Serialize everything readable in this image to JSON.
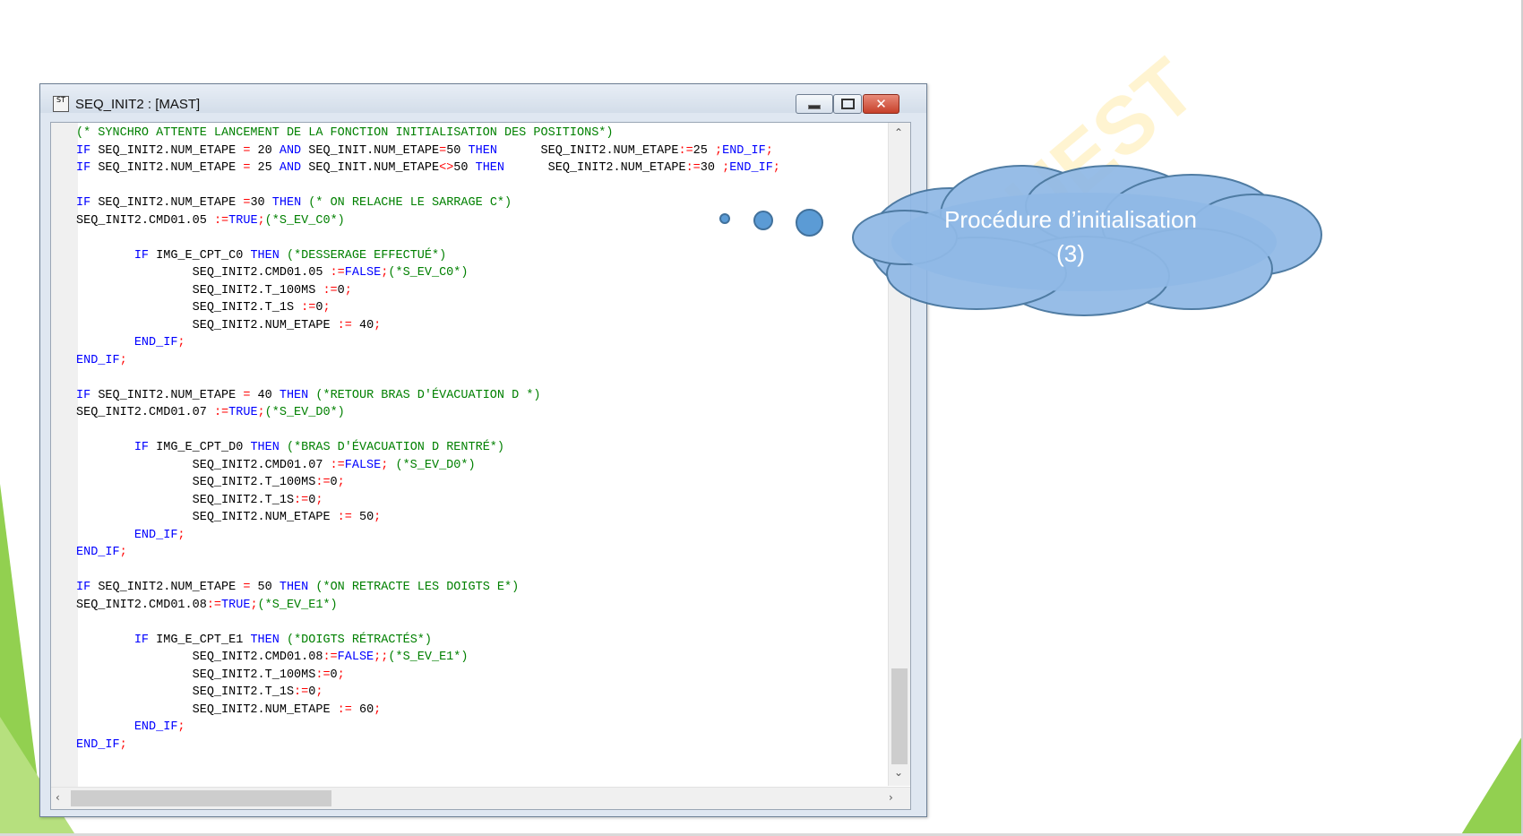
{
  "window": {
    "title": "SEQ_INIT2 : [MAST]",
    "icon_label": "ST"
  },
  "code_lines": [
    [
      [
        "cm",
        "(* SYNCHRO ATTENTE LANCEMENT DE LA FONCTION INITIALISATION DES POSITIONS*)"
      ]
    ],
    [
      [
        "kw",
        "IF "
      ],
      [
        "num",
        "SEQ_INIT2.NUM_ETAPE "
      ],
      [
        "op",
        "= "
      ],
      [
        "num",
        "20 "
      ],
      [
        "kw",
        "AND "
      ],
      [
        "num",
        "SEQ_INIT.NUM_ETAPE"
      ],
      [
        "op",
        "="
      ],
      [
        "num",
        "50 "
      ],
      [
        "kw",
        "THEN"
      ],
      [
        "num",
        "      SEQ_INIT2.NUM_ETAPE"
      ],
      [
        "op",
        ":="
      ],
      [
        "num",
        "25 "
      ],
      [
        "op",
        ";"
      ],
      [
        "kw",
        "END_IF"
      ],
      [
        "op",
        ";"
      ]
    ],
    [
      [
        "kw",
        "IF "
      ],
      [
        "num",
        "SEQ_INIT2.NUM_ETAPE "
      ],
      [
        "op",
        "= "
      ],
      [
        "num",
        "25 "
      ],
      [
        "kw",
        "AND "
      ],
      [
        "num",
        "SEQ_INIT.NUM_ETAPE"
      ],
      [
        "op",
        "<>"
      ],
      [
        "num",
        "50 "
      ],
      [
        "kw",
        "THEN"
      ],
      [
        "num",
        "      SEQ_INIT2.NUM_ETAPE"
      ],
      [
        "op",
        ":="
      ],
      [
        "num",
        "30 "
      ],
      [
        "op",
        ";"
      ],
      [
        "kw",
        "END_IF"
      ],
      [
        "op",
        ";"
      ]
    ],
    [],
    [
      [
        "kw",
        "IF "
      ],
      [
        "num",
        "SEQ_INIT2.NUM_ETAPE "
      ],
      [
        "op",
        "="
      ],
      [
        "num",
        "30 "
      ],
      [
        "kw",
        "THEN "
      ],
      [
        "cm",
        "(* ON RELACHE LE SARRAGE C*)"
      ]
    ],
    [
      [
        "num",
        "SEQ_INIT2.CMD01.05 "
      ],
      [
        "op",
        ":="
      ],
      [
        "kw",
        "TRUE"
      ],
      [
        "op",
        ";"
      ],
      [
        "cm",
        "(*S_EV_C0*)"
      ]
    ],
    [],
    [
      [
        "num",
        "        "
      ],
      [
        "kw",
        "IF "
      ],
      [
        "num",
        "IMG_E_CPT_C0 "
      ],
      [
        "kw",
        "THEN "
      ],
      [
        "cm",
        "(*DESSERAGE EFFECTUÉ*)"
      ]
    ],
    [
      [
        "num",
        "                SEQ_INIT2.CMD01.05 "
      ],
      [
        "op",
        ":="
      ],
      [
        "kw",
        "FALSE"
      ],
      [
        "op",
        ";"
      ],
      [
        "cm",
        "(*S_EV_C0*)"
      ]
    ],
    [
      [
        "num",
        "                SEQ_INIT2.T_100MS "
      ],
      [
        "op",
        ":="
      ],
      [
        "num",
        "0"
      ],
      [
        "op",
        ";"
      ]
    ],
    [
      [
        "num",
        "                SEQ_INIT2.T_1S "
      ],
      [
        "op",
        ":="
      ],
      [
        "num",
        "0"
      ],
      [
        "op",
        ";"
      ]
    ],
    [
      [
        "num",
        "                SEQ_INIT2.NUM_ETAPE "
      ],
      [
        "op",
        ":= "
      ],
      [
        "num",
        "40"
      ],
      [
        "op",
        ";"
      ]
    ],
    [
      [
        "num",
        "        "
      ],
      [
        "kw",
        "END_IF"
      ],
      [
        "op",
        ";"
      ]
    ],
    [
      [
        "kw",
        "END_IF"
      ],
      [
        "op",
        ";"
      ]
    ],
    [],
    [
      [
        "kw",
        "IF "
      ],
      [
        "num",
        "SEQ_INIT2.NUM_ETAPE "
      ],
      [
        "op",
        "= "
      ],
      [
        "num",
        "40 "
      ],
      [
        "kw",
        "THEN "
      ],
      [
        "cm",
        "(*RETOUR BRAS D'ÉVACUATION D *)"
      ]
    ],
    [
      [
        "num",
        "SEQ_INIT2.CMD01.07 "
      ],
      [
        "op",
        ":="
      ],
      [
        "kw",
        "TRUE"
      ],
      [
        "op",
        ";"
      ],
      [
        "cm",
        "(*S_EV_D0*)"
      ]
    ],
    [],
    [
      [
        "num",
        "        "
      ],
      [
        "kw",
        "IF "
      ],
      [
        "num",
        "IMG_E_CPT_D0 "
      ],
      [
        "kw",
        "THEN "
      ],
      [
        "cm",
        "(*BRAS D'ÉVACUATION D RENTRÉ*)"
      ]
    ],
    [
      [
        "num",
        "                SEQ_INIT2.CMD01.07 "
      ],
      [
        "op",
        ":="
      ],
      [
        "kw",
        "FALSE"
      ],
      [
        "op",
        "; "
      ],
      [
        "cm",
        "(*S_EV_D0*)"
      ]
    ],
    [
      [
        "num",
        "                SEQ_INIT2.T_100MS"
      ],
      [
        "op",
        ":="
      ],
      [
        "num",
        "0"
      ],
      [
        "op",
        ";"
      ]
    ],
    [
      [
        "num",
        "                SEQ_INIT2.T_1S"
      ],
      [
        "op",
        ":="
      ],
      [
        "num",
        "0"
      ],
      [
        "op",
        ";"
      ]
    ],
    [
      [
        "num",
        "                SEQ_INIT2.NUM_ETAPE "
      ],
      [
        "op",
        ":= "
      ],
      [
        "num",
        "50"
      ],
      [
        "op",
        ";"
      ]
    ],
    [
      [
        "num",
        "        "
      ],
      [
        "kw",
        "END_IF"
      ],
      [
        "op",
        ";"
      ]
    ],
    [
      [
        "kw",
        "END_IF"
      ],
      [
        "op",
        ";"
      ]
    ],
    [],
    [
      [
        "kw",
        "IF "
      ],
      [
        "num",
        "SEQ_INIT2.NUM_ETAPE "
      ],
      [
        "op",
        "= "
      ],
      [
        "num",
        "50 "
      ],
      [
        "kw",
        "THEN "
      ],
      [
        "cm",
        "(*ON RETRACTE LES DOIGTS E*)"
      ]
    ],
    [
      [
        "num",
        "SEQ_INIT2.CMD01.08"
      ],
      [
        "op",
        ":="
      ],
      [
        "kw",
        "TRUE"
      ],
      [
        "op",
        ";"
      ],
      [
        "cm",
        "(*S_EV_E1*)"
      ]
    ],
    [],
    [
      [
        "num",
        "        "
      ],
      [
        "kw",
        "IF "
      ],
      [
        "num",
        "IMG_E_CPT_E1 "
      ],
      [
        "kw",
        "THEN "
      ],
      [
        "cm",
        "(*DOIGTS RÉTRACTÉS*)"
      ]
    ],
    [
      [
        "num",
        "                SEQ_INIT2.CMD01.08"
      ],
      [
        "op",
        ":="
      ],
      [
        "kw",
        "FALSE"
      ],
      [
        "op",
        ";;"
      ],
      [
        "cm",
        "(*S_EV_E1*)"
      ]
    ],
    [
      [
        "num",
        "                SEQ_INIT2.T_100MS"
      ],
      [
        "op",
        ":="
      ],
      [
        "num",
        "0"
      ],
      [
        "op",
        ";"
      ]
    ],
    [
      [
        "num",
        "                SEQ_INIT2.T_1S"
      ],
      [
        "op",
        ":="
      ],
      [
        "num",
        "0"
      ],
      [
        "op",
        ";"
      ]
    ],
    [
      [
        "num",
        "                SEQ_INIT2.NUM_ETAPE "
      ],
      [
        "op",
        ":= "
      ],
      [
        "num",
        "60"
      ],
      [
        "op",
        ";"
      ]
    ],
    [
      [
        "num",
        "        "
      ],
      [
        "kw",
        "END_IF"
      ],
      [
        "op",
        ";"
      ]
    ],
    [
      [
        "kw",
        "END_IF"
      ],
      [
        "op",
        ";"
      ]
    ]
  ],
  "callout": {
    "line1": "Procédure d’initialisation",
    "line2": "(3)"
  },
  "watermark": "OUEST",
  "colors": {
    "keyword": "#0000ff",
    "comment": "#008000",
    "operator": "#ff0000",
    "cloud_fill": "#8fb8e6",
    "slide_green": "#92d050"
  },
  "icons": {
    "minimize": "minimize-icon",
    "maximize": "maximize-icon",
    "close": "close-icon",
    "scroll_up": "chevron-up-icon",
    "scroll_down": "chevron-down-icon",
    "scroll_left": "chevron-left-icon",
    "scroll_right": "chevron-right-icon"
  }
}
